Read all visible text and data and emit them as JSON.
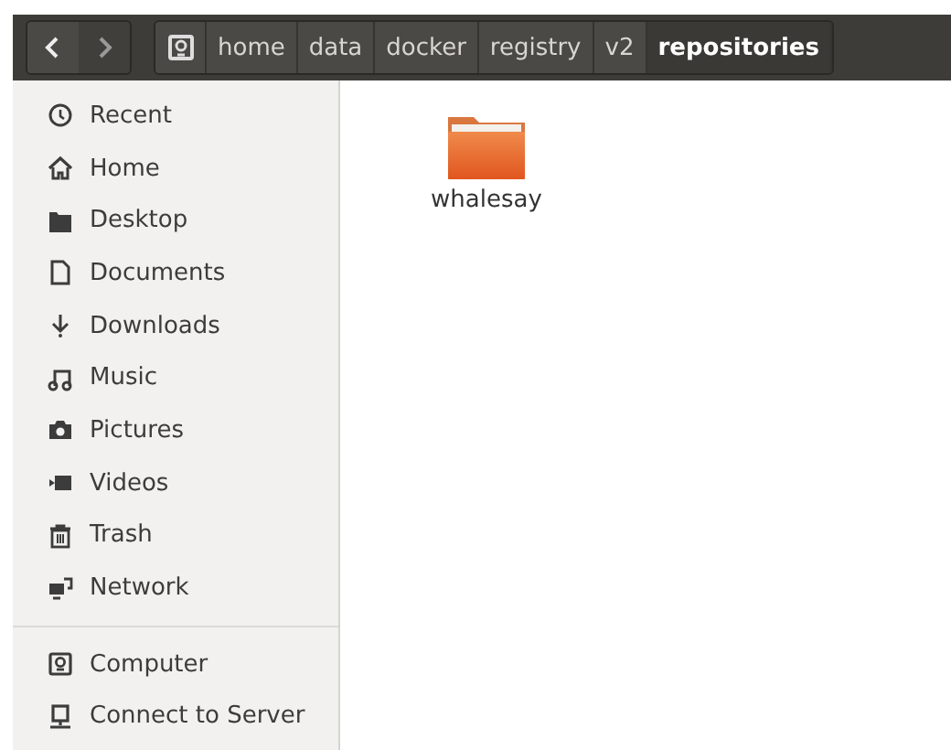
{
  "path_bar": {
    "crumbs": [
      {
        "label": "home",
        "selected": false
      },
      {
        "label": "data",
        "selected": false
      },
      {
        "label": "docker",
        "selected": false
      },
      {
        "label": "registry",
        "selected": false
      },
      {
        "label": "v2",
        "selected": false
      },
      {
        "label": "repositories",
        "selected": true
      }
    ]
  },
  "sidebar": {
    "groups": [
      {
        "items": [
          {
            "label": "Recent"
          },
          {
            "label": "Home"
          },
          {
            "label": "Desktop"
          },
          {
            "label": "Documents"
          },
          {
            "label": "Downloads"
          },
          {
            "label": "Music"
          },
          {
            "label": "Pictures"
          },
          {
            "label": "Videos"
          },
          {
            "label": "Trash"
          },
          {
            "label": "Network"
          }
        ]
      },
      {
        "items": [
          {
            "label": "Computer"
          },
          {
            "label": "Connect to Server"
          }
        ]
      }
    ]
  },
  "files": [
    {
      "name": "whalesay",
      "kind": "folder"
    }
  ]
}
